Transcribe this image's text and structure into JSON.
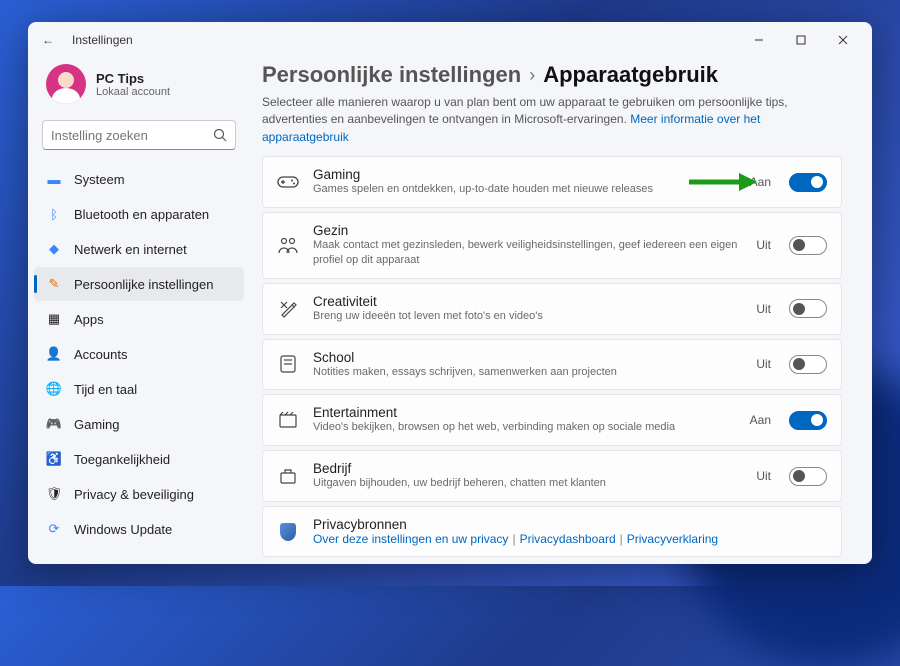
{
  "window": {
    "title": "Instellingen"
  },
  "profile": {
    "name": "PC Tips",
    "sub": "Lokaal account"
  },
  "search": {
    "placeholder": "Instelling zoeken"
  },
  "nav": {
    "systeem": "Systeem",
    "bluetooth": "Bluetooth en apparaten",
    "netwerk": "Netwerk en internet",
    "persoonlijk": "Persoonlijke instellingen",
    "apps": "Apps",
    "accounts": "Accounts",
    "tijd": "Tijd en taal",
    "gaming": "Gaming",
    "toegankelijkheid": "Toegankelijkheid",
    "privacy": "Privacy & beveiliging",
    "update": "Windows Update"
  },
  "breadcrumb": {
    "parent": "Persoonlijke instellingen",
    "current": "Apparaatgebruik"
  },
  "desc": {
    "text": "Selecteer alle manieren waarop u van plan bent om uw apparaat te gebruiken om persoonlijke tips, advertenties en aanbevelingen te ontvangen in Microsoft-ervaringen. ",
    "link": "Meer informatie over het apparaatgebruik"
  },
  "states": {
    "on": "Aan",
    "off": "Uit"
  },
  "cards": {
    "gaming": {
      "title": "Gaming",
      "sub": "Games spelen en ontdekken, up-to-date houden met nieuwe releases",
      "on": true
    },
    "gezin": {
      "title": "Gezin",
      "sub": "Maak contact met gezinsleden, bewerk veiligheidsinstellingen, geef iedereen een eigen profiel op dit apparaat",
      "on": false
    },
    "creativiteit": {
      "title": "Creativiteit",
      "sub": "Breng uw ideeën tot leven met foto's en video's",
      "on": false
    },
    "school": {
      "title": "School",
      "sub": "Notities maken, essays schrijven, samenwerken aan projecten",
      "on": false
    },
    "entertainment": {
      "title": "Entertainment",
      "sub": "Video's bekijken, browsen op het web, verbinding maken op sociale media",
      "on": true
    },
    "bedrijf": {
      "title": "Bedrijf",
      "sub": "Uitgaven bijhouden, uw bedrijf beheren, chatten met klanten",
      "on": false
    }
  },
  "privacySources": {
    "title": "Privacybronnen",
    "link1": "Over deze instellingen en uw privacy",
    "link2": "Privacydashboard",
    "link3": "Privacyverklaring"
  }
}
